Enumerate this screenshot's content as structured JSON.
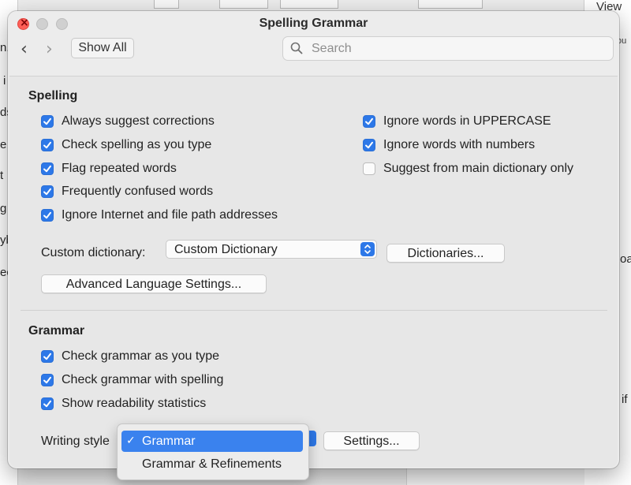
{
  "background": {
    "left_fragments": [
      "n.",
      "i",
      "ds",
      "e",
      "t",
      "g",
      "yb",
      "ec"
    ],
    "right_fragments": [
      "oa",
      "if"
    ],
    "view_label": "View",
    "view_sub": "ou"
  },
  "window": {
    "title": "Spelling  Grammar",
    "show_all": "Show All",
    "search_placeholder": "Search",
    "search_value": ""
  },
  "spelling": {
    "heading": "Spelling",
    "left_options": [
      {
        "label": "Always suggest corrections",
        "checked": true
      },
      {
        "label": "Check spelling as you type",
        "checked": true
      },
      {
        "label": "Flag repeated words",
        "checked": true
      },
      {
        "label": "Frequently confused words",
        "checked": true
      },
      {
        "label": "Ignore Internet and file path addresses",
        "checked": true
      }
    ],
    "right_options": [
      {
        "label": "Ignore words in UPPERCASE",
        "checked": true
      },
      {
        "label": "Ignore words with numbers",
        "checked": true
      },
      {
        "label": "Suggest from main dictionary only",
        "checked": false
      }
    ],
    "custom_dictionary_label": "Custom dictionary:",
    "custom_dictionary_value": "Custom Dictionary",
    "dictionaries_button": "Dictionaries...",
    "advanced_button": "Advanced Language Settings..."
  },
  "grammar": {
    "heading": "Grammar",
    "options": [
      {
        "label": "Check grammar as you type",
        "checked": true
      },
      {
        "label": "Check grammar with spelling",
        "checked": true
      },
      {
        "label": "Show readability statistics",
        "checked": true
      }
    ],
    "writing_style_label": "Writing style",
    "settings_button": "Settings...",
    "writing_style_menu": [
      {
        "label": "Grammar",
        "selected": true
      },
      {
        "label": "Grammar & Refinements",
        "selected": false
      }
    ]
  },
  "colors": {
    "accent": "#2d78e8",
    "menu_highlight": "#3a82ee",
    "close_button": "#ff5f57"
  }
}
